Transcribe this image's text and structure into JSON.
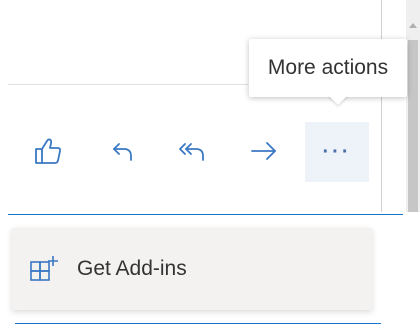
{
  "tooltip": {
    "text": "More actions"
  },
  "toolbar": {
    "like_icon": "thumbs-up-icon",
    "reply_icon": "reply-icon",
    "reply_all_icon": "reply-all-icon",
    "forward_icon": "forward-arrow-icon",
    "more_label": "···"
  },
  "menu": {
    "items": [
      {
        "label": "Get Add-ins",
        "icon": "add-ins-grid-icon"
      }
    ]
  },
  "colors": {
    "accent": "#1a73c6",
    "icon_blue": "#3b78c3",
    "more_button_bg": "#eef3f9",
    "menu_bg": "#f3f2f1"
  }
}
